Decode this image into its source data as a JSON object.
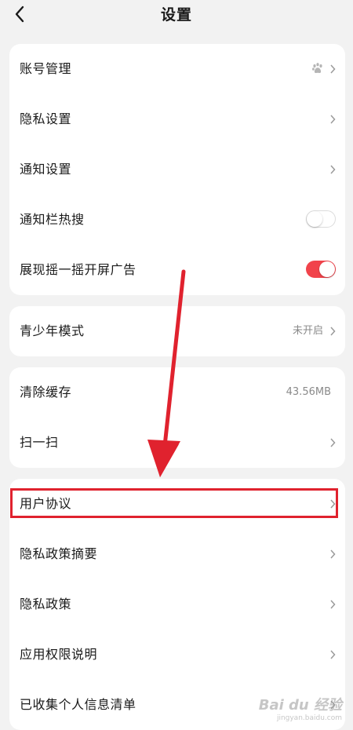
{
  "header": {
    "title": "设置"
  },
  "group1": {
    "items": [
      {
        "label": "账号管理"
      },
      {
        "label": "隐私设置"
      },
      {
        "label": "通知设置"
      },
      {
        "label": "通知栏热搜",
        "toggle": "off"
      },
      {
        "label": "展现摇一摇开屏广告",
        "toggle": "on"
      }
    ]
  },
  "group2": {
    "items": [
      {
        "label": "青少年模式",
        "value": "未开启"
      }
    ]
  },
  "group3": {
    "items": [
      {
        "label": "清除缓存",
        "value": "43.56MB"
      },
      {
        "label": "扫一扫"
      }
    ]
  },
  "group4": {
    "items": [
      {
        "label": "用户协议"
      },
      {
        "label": "隐私政策摘要"
      },
      {
        "label": "隐私政策"
      },
      {
        "label": "应用权限说明"
      },
      {
        "label": "已收集个人信息清单"
      }
    ]
  },
  "colors": {
    "accent": "#f1434b",
    "annotation": "#e0222e",
    "background": "#f2f2f2"
  },
  "watermark": {
    "text": "Bai du 经验",
    "sub": "jingyan.baidu.com"
  }
}
